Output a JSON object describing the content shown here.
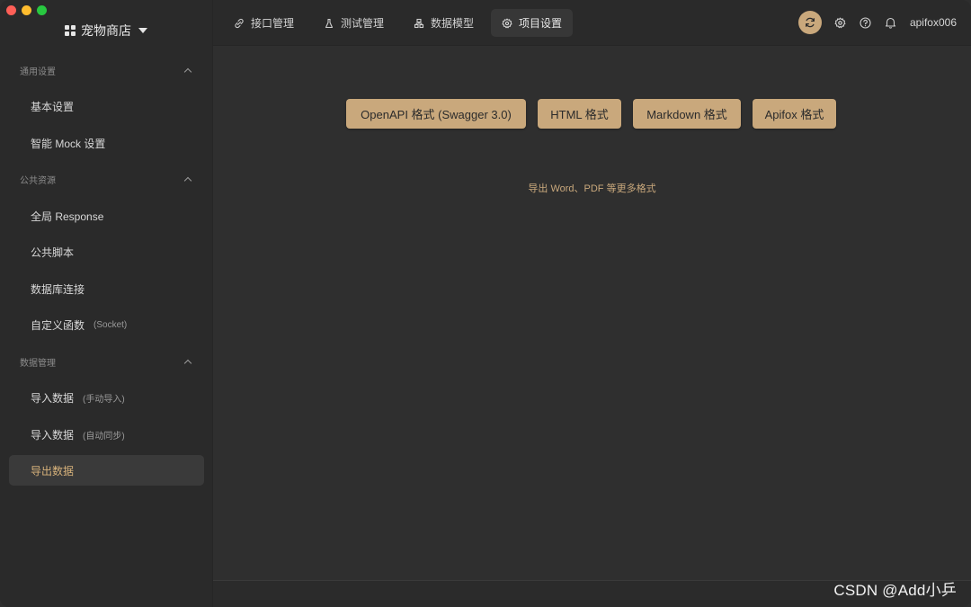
{
  "project": {
    "name": "宠物商店",
    "icon": "grid-icon"
  },
  "sidebar": {
    "sections": [
      {
        "title": "通用设置",
        "items": [
          {
            "label": "基本设置",
            "sub": ""
          },
          {
            "label": "智能 Mock 设置",
            "sub": ""
          }
        ]
      },
      {
        "title": "公共资源",
        "items": [
          {
            "label": "全局 Response",
            "sub": ""
          },
          {
            "label": "公共脚本",
            "sub": ""
          },
          {
            "label": "数据库连接",
            "sub": ""
          },
          {
            "label": "自定义函数",
            "sub": "(Socket)"
          }
        ]
      },
      {
        "title": "数据管理",
        "items": [
          {
            "label": "导入数据",
            "sub": "(手动导入)"
          },
          {
            "label": "导入数据",
            "sub": "(自动同步)"
          },
          {
            "label": "导出数据",
            "sub": ""
          }
        ]
      }
    ],
    "active_item": "导出数据"
  },
  "tabs": [
    {
      "label": "接口管理",
      "icon": "link-icon"
    },
    {
      "label": "测试管理",
      "icon": "flask-icon"
    },
    {
      "label": "数据模型",
      "icon": "model-icon"
    },
    {
      "label": "项目设置",
      "icon": "gear-icon",
      "active": true
    }
  ],
  "header": {
    "username": "apifox006"
  },
  "main": {
    "buttons": [
      "OpenAPI 格式 (Swagger 3.0)",
      "HTML 格式",
      "Markdown 格式",
      "Apifox 格式"
    ],
    "more_link": "导出 Word、PDF 等更多格式"
  },
  "watermark": "CSDN @Add小乒",
  "colors": {
    "accent": "#c9a87c",
    "background": "#2f2f2f",
    "sidebar": "#2a2a2a"
  }
}
